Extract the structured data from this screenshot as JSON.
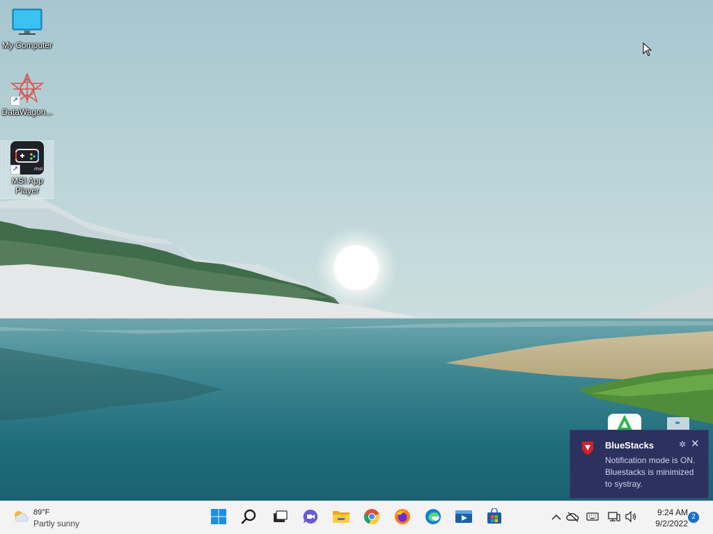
{
  "desktop": {
    "icons": [
      {
        "label": "My Computer"
      },
      {
        "label": "DataWagon..."
      },
      {
        "label": "MSI App Player"
      }
    ]
  },
  "notification": {
    "app": "BlueStacks",
    "message": "Notification mode is ON. Bluestacks is minimized to systray."
  },
  "taskbar": {
    "weather": {
      "temp": "89°F",
      "condition": "Partly sunny"
    },
    "apps": [
      "start-icon",
      "search-icon",
      "task-view-icon",
      "chat-icon",
      "file-explorer-icon",
      "chrome-icon",
      "firefox-icon",
      "edge-icon",
      "media-player-icon",
      "store-icon"
    ],
    "clock": {
      "time": "9:24 AM",
      "date": "9/2/2022"
    },
    "notification_count": "2"
  },
  "colors": {
    "accent": "#1a6ec8",
    "toast_bg": "#2c3160",
    "taskbar_bg": "#f3f3f3"
  }
}
